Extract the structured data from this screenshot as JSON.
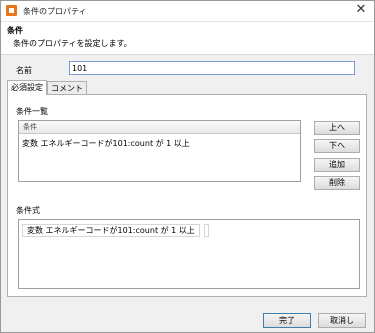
{
  "window": {
    "title": "条件のプロパティ"
  },
  "header": {
    "title": "条件",
    "description": "条件のプロパティを設定します。"
  },
  "name": {
    "label": "名前",
    "value": "101"
  },
  "tabs": [
    {
      "label": "必須設定"
    },
    {
      "label": "コメント"
    }
  ],
  "conditions": {
    "section_label": "条件一覧",
    "column_header": "条件",
    "items": [
      {
        "text": "変数 エネルギーコードが101:count が 1 以上"
      }
    ],
    "buttons": {
      "up": "上へ",
      "down": "下へ",
      "add": "追加",
      "delete": "削除"
    }
  },
  "expression": {
    "section_label": "条件式",
    "text": "変数 エネルギーコードが101:count が 1 以上"
  },
  "footer": {
    "ok": "完了",
    "cancel": "取消し"
  }
}
